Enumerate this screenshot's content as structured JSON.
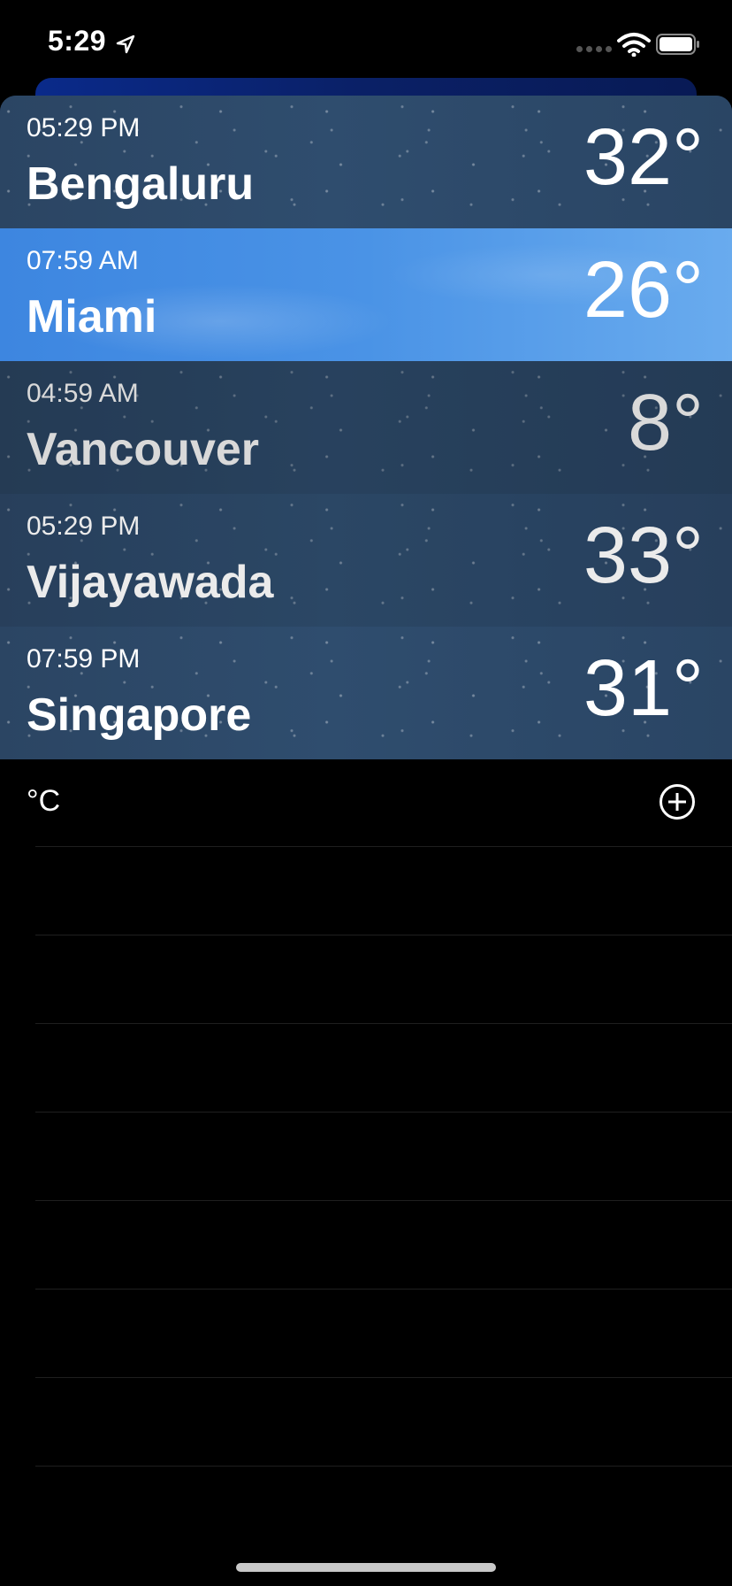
{
  "status_bar": {
    "time": "5:29",
    "icons": [
      "location-arrow-icon",
      "signal-icon",
      "wifi-icon",
      "battery-icon"
    ]
  },
  "cities": [
    {
      "time": "05:29 PM",
      "name": "Bengaluru",
      "temp": "32°",
      "style": "night"
    },
    {
      "time": "07:59 AM",
      "name": "Miami",
      "temp": "26°",
      "style": "day"
    },
    {
      "time": "04:59 AM",
      "name": "Vancouver",
      "temp": "8°",
      "style": "night"
    },
    {
      "time": "05:29 PM",
      "name": "Vijayawada",
      "temp": "33°",
      "style": "night"
    },
    {
      "time": "07:59 PM",
      "name": "Singapore",
      "temp": "31°",
      "style": "night"
    }
  ],
  "footer": {
    "units_label": "°C",
    "add_icon": "add-circle-icon"
  },
  "colors": {
    "background": "#000000",
    "night_row": "#2b4563",
    "day_row": "#4a93e6"
  }
}
